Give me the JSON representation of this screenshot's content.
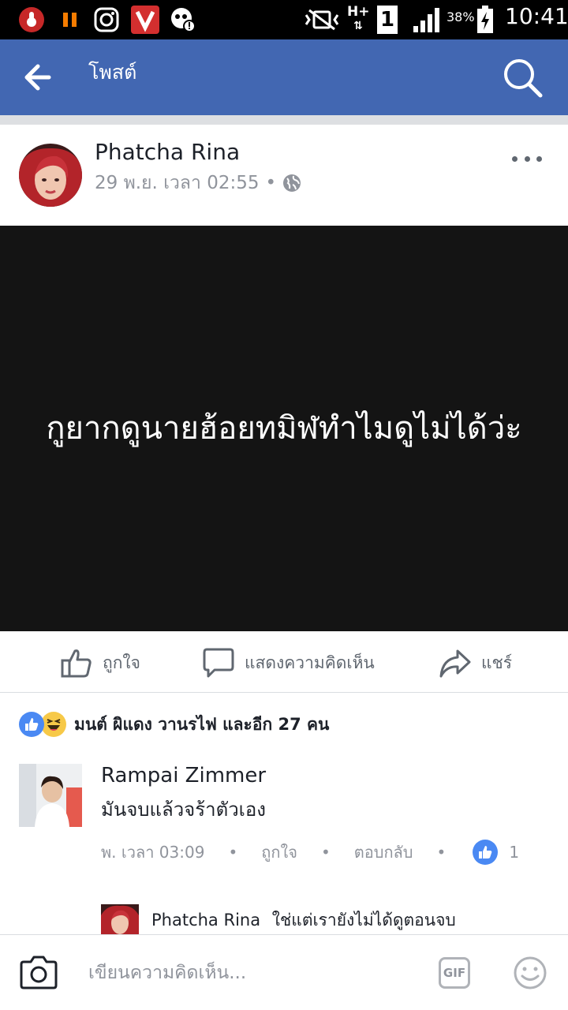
{
  "status_bar": {
    "battery_percent": "38%",
    "time": "10:41",
    "network": "H+",
    "sim": "1"
  },
  "app_bar": {
    "title": "โพสต์"
  },
  "post": {
    "author_name": "Phatcha Rina",
    "timestamp": "29 พ.ย. เวลา 02:55",
    "meta_dot": "•",
    "text": "กูยากดูนายฮ้อยทมิฬทำไมดูไม่ได้ว่ะ",
    "background_color": "#141414"
  },
  "actions": {
    "like": "ถูกใจ",
    "comment": "แสดงความคิดเห็น",
    "share": "แชร์"
  },
  "reactions": {
    "summary": "มนต์ ผิแดง วานรไฟ และอีก 27 คน"
  },
  "comment": {
    "author": "Rampai Zimmer",
    "text": "มันจบแล้วจร้าตัวเอง",
    "time": "พ. เวลา 03:09",
    "like": "ถูกใจ",
    "reply": "ตอบกลับ",
    "separator": "•",
    "like_count": "1"
  },
  "reply": {
    "author": "Phatcha Rina",
    "text": "ใช่แต่เรายังไม่ได้ดูตอนจบ"
  },
  "composer": {
    "placeholder": "เขียนความคิดเห็น...",
    "gif_label": "GIF"
  },
  "colors": {
    "brand": "#4267b2",
    "like_blue": "#4a89f3"
  }
}
